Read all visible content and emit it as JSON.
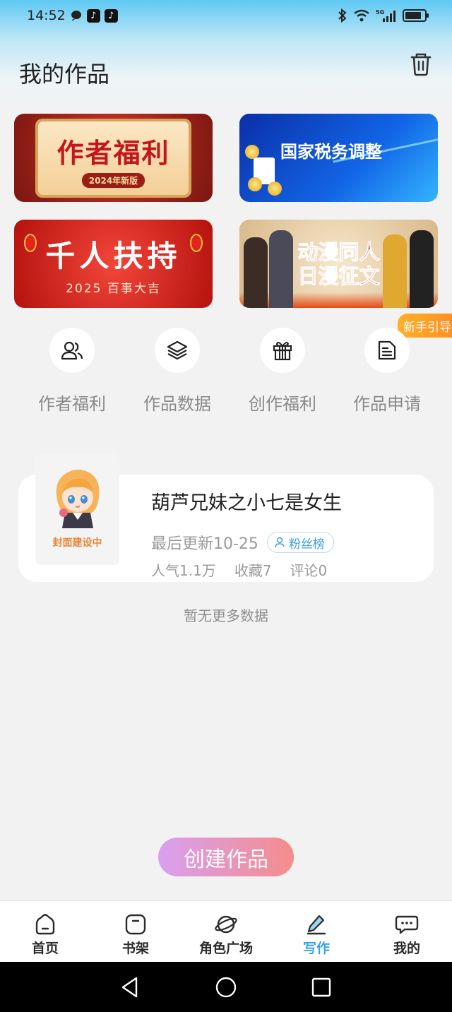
{
  "status_bar": {
    "time": "14:52",
    "signal_label": "5G",
    "battery_level": 0.85
  },
  "header": {
    "title": "我的作品"
  },
  "banners": [
    {
      "title": "作者福利",
      "subtitle": "2024年新版"
    },
    {
      "title": "国家税务调整"
    },
    {
      "title": "千人扶持",
      "subtitle": "2025 百事大吉"
    },
    {
      "title_line1": "动漫同人",
      "title_line2": "日漫征文"
    }
  ],
  "guide_badge": "新手引导",
  "quick_menu": [
    {
      "label": "作者福利",
      "icon": "users-icon"
    },
    {
      "label": "作品数据",
      "icon": "layers-icon"
    },
    {
      "label": "创作福利",
      "icon": "gift-icon"
    },
    {
      "label": "作品申请",
      "icon": "document-icon"
    }
  ],
  "work": {
    "cover_text": "封面建设中",
    "title": "葫芦兄妹之小七是女生",
    "updated": "最后更新10-25",
    "fans_tag": "粉丝榜",
    "popularity": "人气1.1万",
    "favorites": "收藏7",
    "comments": "评论0"
  },
  "no_more": "暂无更多数据",
  "create_button": "创建作品",
  "bottom_nav": [
    {
      "label": "首页",
      "icon": "home-icon"
    },
    {
      "label": "书架",
      "icon": "bookshelf-icon"
    },
    {
      "label": "角色广场",
      "icon": "planet-icon"
    },
    {
      "label": "写作",
      "icon": "pen-icon",
      "active": true
    },
    {
      "label": "我的",
      "icon": "chat-icon"
    }
  ],
  "colors": {
    "accent": "#3aa3e8",
    "header_blue": "#5ec9f4",
    "guide_orange": "#ff9a22",
    "create_gradient_start": "#d9a0f0",
    "create_gradient_end": "#f58c8c"
  }
}
